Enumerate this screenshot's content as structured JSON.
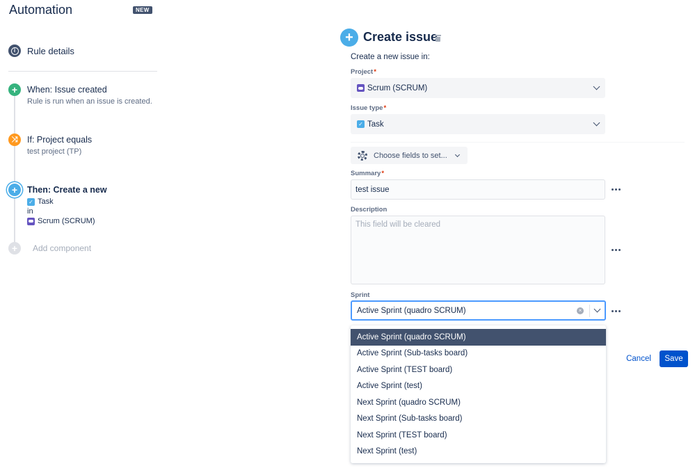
{
  "sidebar": {
    "title": "Automation",
    "badge": "NEW",
    "rule_details": "Rule details",
    "steps": {
      "trigger": {
        "title": "When: Issue created",
        "subtitle": "Rule is run when an issue is created."
      },
      "condition": {
        "title": "If: Project equals",
        "subtitle": "test project (TP)"
      },
      "action": {
        "title": "Then: Create a new",
        "issue_type": "Task",
        "in": "in",
        "project": "Scrum (SCRUM)"
      }
    },
    "add_component": "Add component"
  },
  "form": {
    "title": "Create issue",
    "subtitle": "Create a new issue in:",
    "project": {
      "label": "Project",
      "value": "Scrum (SCRUM)"
    },
    "issue_type": {
      "label": "Issue type",
      "value": "Task"
    },
    "choose_fields": "Choose fields to set...",
    "summary": {
      "label": "Summary",
      "value": "test issue"
    },
    "description": {
      "label": "Description",
      "placeholder": "This field will be cleared"
    },
    "sprint": {
      "label": "Sprint",
      "value": "Active Sprint (quadro SCRUM)",
      "options": [
        "Active Sprint (quadro SCRUM)",
        "Active Sprint (Sub-tasks board)",
        "Active Sprint (TEST board)",
        "Active Sprint (test)",
        "Next Sprint (quadro SCRUM)",
        "Next Sprint (Sub-tasks board)",
        "Next Sprint (TEST board)",
        "Next Sprint (test)"
      ]
    },
    "cancel": "Cancel",
    "save": "Save"
  },
  "colors": {
    "trigger": "#36b37e",
    "condition": "#ff991f",
    "action": "#4bade8",
    "primary": "#0052cc"
  },
  "icons": {
    "rule_details": "info-icon",
    "trigger": "plus-icon",
    "condition": "shuffle-icon",
    "action": "plus-icon",
    "issue_type": "task-checkbox-icon",
    "project": "project-avatar-icon",
    "choose_fields": "gear-icon",
    "more": "more-dots-icon"
  }
}
